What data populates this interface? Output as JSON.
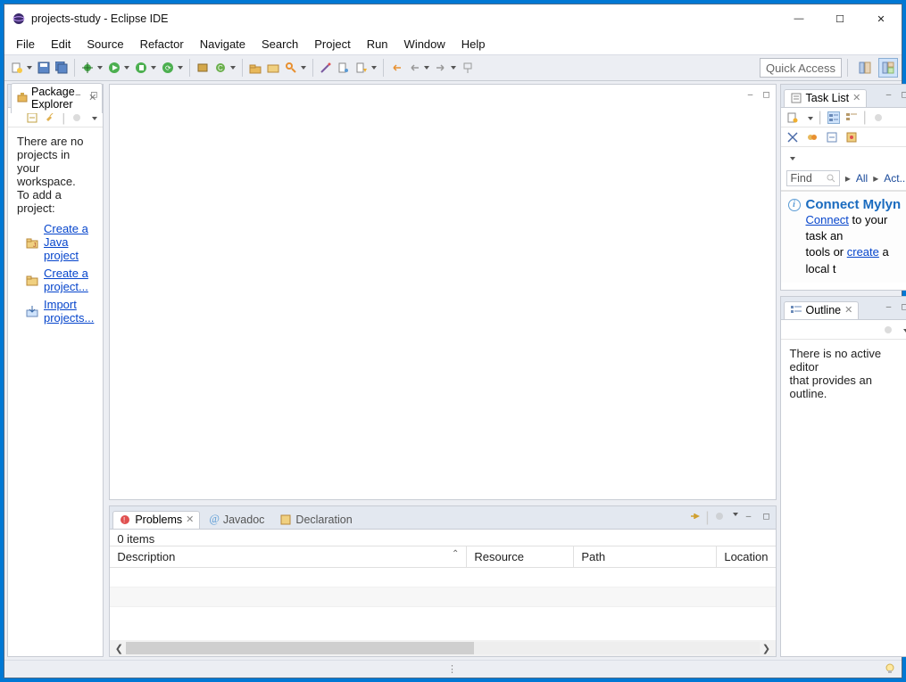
{
  "window": {
    "title": "projects-study - Eclipse IDE"
  },
  "menubar": [
    "File",
    "Edit",
    "Source",
    "Refactor",
    "Navigate",
    "Search",
    "Project",
    "Run",
    "Window",
    "Help"
  ],
  "toolbar": {
    "quick_access": "Quick Access"
  },
  "packageExplorer": {
    "tab": "Package Explorer",
    "body_line1": "There are no projects in your",
    "body_line2": "workspace.",
    "body_line3": "To add a project:",
    "link_java": "Create a Java project",
    "link_project": "Create a project...",
    "link_import": "Import projects..."
  },
  "taskList": {
    "tab": "Task List",
    "find": "Find",
    "filter_all": "All",
    "filter_act": "Act...",
    "mylyn_title": "Connect Mylyn",
    "mylyn_connect": "Connect",
    "mylyn_text1": " to your task an",
    "mylyn_text2": "tools or ",
    "mylyn_create": "create",
    "mylyn_text3": " a local t"
  },
  "outline": {
    "tab": "Outline",
    "body_line1": "There is no active editor",
    "body_line2": "that provides an outline."
  },
  "problems": {
    "tab_problems": "Problems",
    "tab_javadoc": "Javadoc",
    "tab_declaration": "Declaration",
    "items_label": "0 items",
    "columns": {
      "description": "Description",
      "resource": "Resource",
      "path": "Path",
      "location": "Location"
    }
  }
}
